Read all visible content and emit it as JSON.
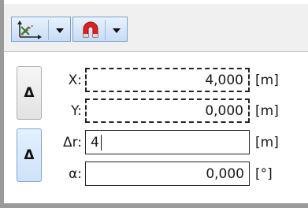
{
  "toolbar": {
    "buttons": [
      {
        "icon": "coordinate-axes-icon",
        "has_dropdown": true
      },
      {
        "icon": "magnet-snap-icon",
        "has_dropdown": true
      }
    ]
  },
  "toggles": {
    "first_label": "Δ",
    "second_label": "Δ"
  },
  "fields": {
    "x": {
      "label": "X:",
      "value": "4,000",
      "unit": "[m]"
    },
    "y": {
      "label": "Y:",
      "value": "0,000",
      "unit": "[m]"
    },
    "dr": {
      "label": "Δr:",
      "value": "4",
      "unit": "[m]"
    },
    "a": {
      "label": "α:",
      "value": "0,000",
      "unit": "[°]"
    }
  },
  "colors": {
    "toolbar_accent": "#7aa0d0",
    "magnet": "#e02020"
  }
}
